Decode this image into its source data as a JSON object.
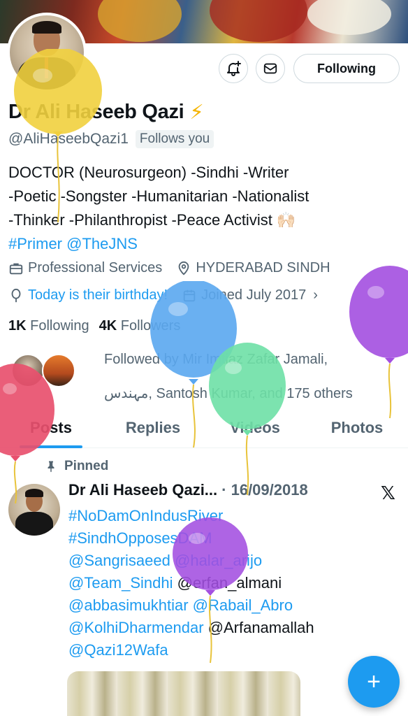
{
  "profile": {
    "name": "Dr Ali Haseeb Qazi",
    "verified_emoji": "⚡",
    "handle": "@AliHaseebQazi1",
    "follows_you": "Follows you",
    "follow_button": "Following",
    "bio_lines": [
      "DOCTOR (Neurosurgeon) -Sindhi -Writer",
      "-Poetic -Songster -Humanitarian -Nationalist",
      "-Thinker -Philanthropist -Peace Activist 🙌🏻"
    ],
    "bio_links": [
      "#Primer",
      "@TheJNS"
    ],
    "category": "Professional Services",
    "location": "HYDERABAD SINDH",
    "birthday": "Today is their birthday!",
    "joined": "Joined July 2017",
    "following_count": "1K",
    "following_label": "Following",
    "followers_count": "4K",
    "followers_label": "Followers",
    "followed_by_line1": "Followed by Mir Imtiaz Zafar Jamali,",
    "followed_by_line2": "مہندس, Santosh Kumar, and 175 others"
  },
  "tabs": [
    "Posts",
    "Replies",
    "Videos",
    "Photos"
  ],
  "active_tab": "Posts",
  "pinned_post": {
    "pinned_label": "Pinned",
    "author": "Dr Ali Haseeb Qazi...",
    "date": "· 16/09/2018",
    "lines": [
      [
        {
          "t": "#NoDamOnIndusRiver",
          "link": true
        }
      ],
      [
        {
          "t": "#SindhOpposesDAM",
          "link": true
        }
      ],
      [
        {
          "t": "@Sangrisaeed",
          "link": true
        },
        {
          "t": " ",
          "link": false
        },
        {
          "t": "@halar_arijo",
          "link": true
        }
      ],
      [
        {
          "t": "@Team_Sindhi",
          "link": true
        },
        {
          "t": " @erfan_almani",
          "link": false
        }
      ],
      [
        {
          "t": "@abbasimukhtiar",
          "link": true
        },
        {
          "t": " ",
          "link": false
        },
        {
          "t": "@Rabail_Abro",
          "link": true
        }
      ],
      [
        {
          "t": "@KolhiDharmendar",
          "link": true
        },
        {
          "t": " @Arfanamallah",
          "link": false
        }
      ],
      [
        {
          "t": "@Qazi12Wafa",
          "link": true
        }
      ]
    ]
  },
  "fab_label": "+",
  "colors": {
    "accent": "#1d9bf0",
    "balloon_yellow": "#f1d03e",
    "balloon_blue": "#5aa7f0",
    "balloon_green": "#6ee0a6",
    "balloon_purple": "#a34fe0",
    "balloon_pink": "#e8506e"
  }
}
